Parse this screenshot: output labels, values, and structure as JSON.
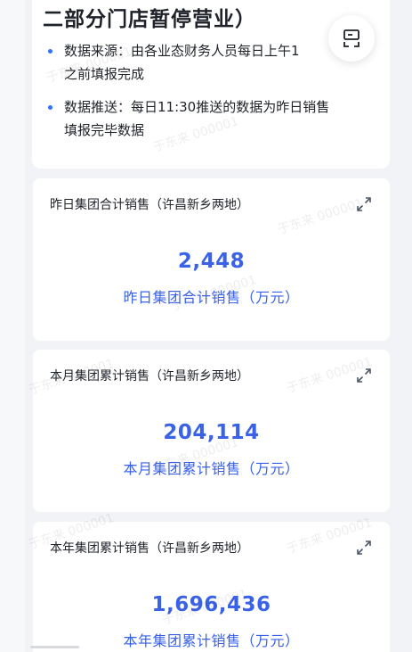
{
  "notice": {
    "title": "二部分门店暂停营业）",
    "items": [
      {
        "line1": "数据来源：由各业态财务人员每日上午1",
        "line2": "之前填报完成"
      },
      {
        "line1": "数据推送：每日11:30推送的数据为昨日销售",
        "line2": "填报完毕数据"
      }
    ]
  },
  "fab": {
    "icon": "panel-icon"
  },
  "metrics": [
    {
      "title": "昨日集团合计销售（许昌新乡两地）",
      "value": "2,448",
      "label": "昨日集团合计销售（万元）"
    },
    {
      "title": "本月集团累计销售（许昌新乡两地）",
      "value": "204,114",
      "label": "本月集团累计销售（万元）"
    },
    {
      "title": "本年集团累计销售（许昌新乡两地）",
      "value": "1,696,436",
      "label": "本年集团累计销售（万元）"
    }
  ],
  "watermark": "于东来 000001",
  "colors": {
    "accent": "#3a62e8",
    "bullet": "#3370ff",
    "background": "#f2f3f6"
  }
}
